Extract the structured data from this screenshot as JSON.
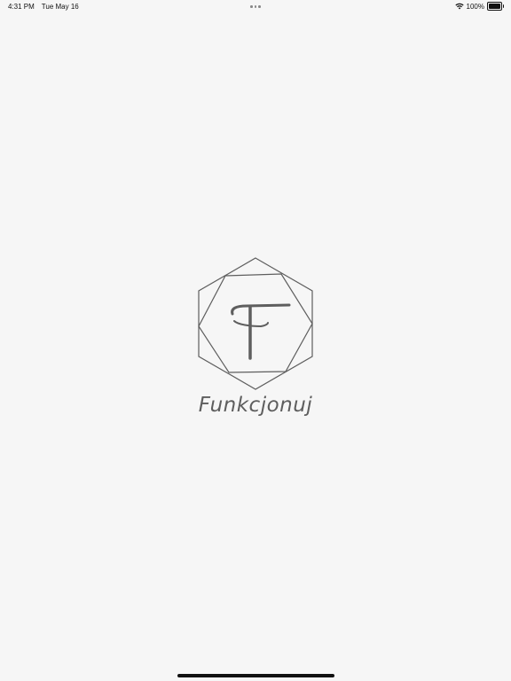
{
  "status_bar": {
    "time": "4:31 PM",
    "date": "Tue May 16",
    "battery_text": "100%",
    "icons": [
      "multitasking-dots-icon",
      "wifi-icon",
      "battery-icon"
    ]
  },
  "splash": {
    "wordmark": "Funkcjonuj",
    "logo_icon": "hexagon-f-logo-icon"
  },
  "colors": {
    "background": "#f6f6f6",
    "logo": "#5e5e5e",
    "status_text": "#111111"
  }
}
